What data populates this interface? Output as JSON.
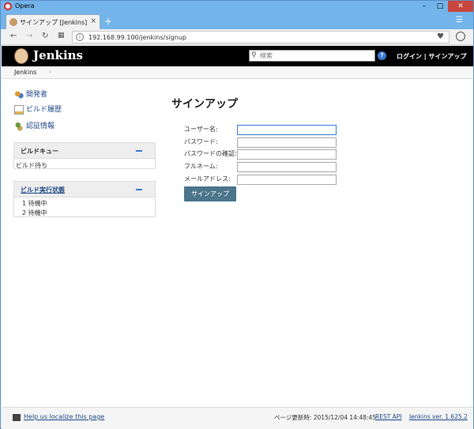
{
  "browser": {
    "app_title": "Opera",
    "tab_title": "サインアップ [Jenkins]",
    "url": "192.168.99.100/jenkins/signup"
  },
  "header": {
    "brand": "Jenkins",
    "search_placeholder": "検索",
    "login_link": "ログイン | サインアップ"
  },
  "breadcrumb": {
    "root": "Jenkins",
    "separator": "›"
  },
  "sidebar": {
    "tasks": [
      {
        "label": "開発者",
        "icon": "people-icon"
      },
      {
        "label": "ビルド履歴",
        "icon": "notepad-icon"
      },
      {
        "label": "認証情報",
        "icon": "credentials-icon"
      }
    ],
    "build_queue": {
      "title": "ビルドキュー",
      "status": "ビルド待ち"
    },
    "executors": {
      "title": "ビルド実行状態",
      "rows": [
        "1  待機中",
        "2  待機中"
      ]
    }
  },
  "main": {
    "title": "サインアップ",
    "fields": [
      {
        "label": "ユーザー名:",
        "value": ""
      },
      {
        "label": "パスワード:",
        "value": ""
      },
      {
        "label": "パスワードの確認:",
        "value": ""
      },
      {
        "label": "フルネーム:",
        "value": ""
      },
      {
        "label": "メールアドレス:",
        "value": ""
      }
    ],
    "submit_label": "サインアップ"
  },
  "footer": {
    "localize": "Help us localize this page",
    "generated": "ページ更新時: 2015/12/04 14:48:45",
    "rest_api": "REST API",
    "version": "Jenkins ver. 1.625.2"
  }
}
